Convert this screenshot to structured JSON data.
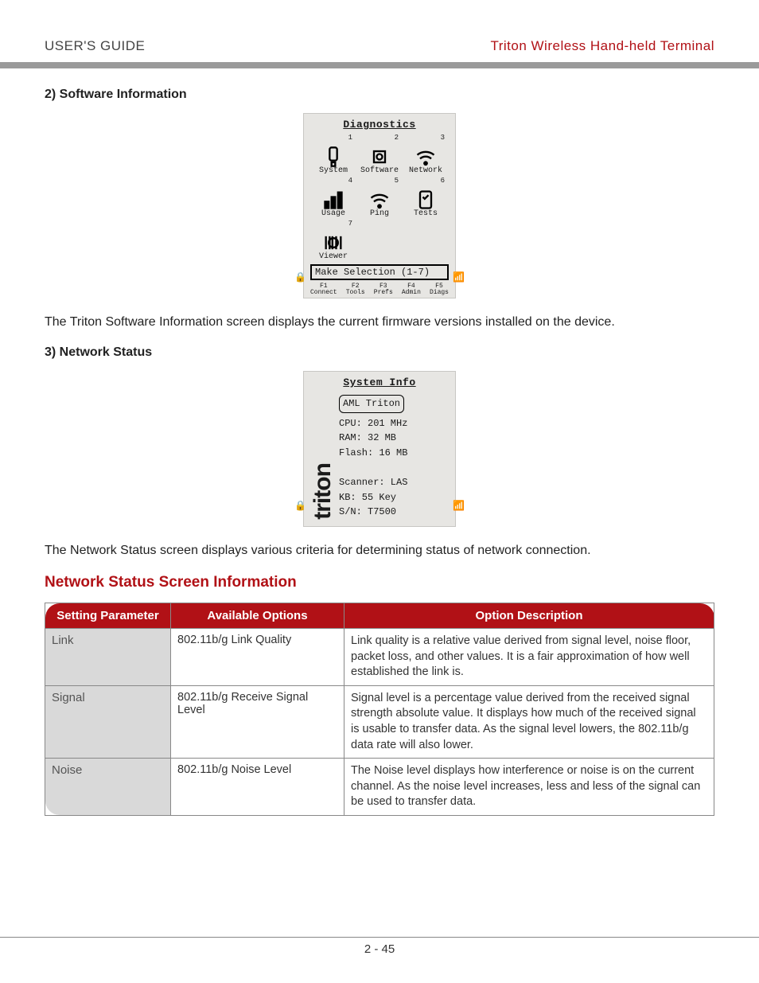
{
  "header": {
    "left": "USER'S GUIDE",
    "right": "Triton Wireless Hand-held Terminal"
  },
  "section1": {
    "heading": "2) Software Information",
    "body": "The Triton Software Information screen displays the current firmware versions installed on the device."
  },
  "fig_diag": {
    "title": "Diagnostics",
    "items": [
      {
        "num": "1",
        "label": "System",
        "icon": "device-icon"
      },
      {
        "num": "2",
        "label": "Software",
        "icon": "chip-icon"
      },
      {
        "num": "3",
        "label": "Network",
        "icon": "wifi-icon"
      },
      {
        "num": "4",
        "label": "Usage",
        "icon": "bars-icon"
      },
      {
        "num": "5",
        "label": "Ping",
        "icon": "wifi-icon"
      },
      {
        "num": "6",
        "label": "Tests",
        "icon": "clipboard-icon"
      },
      {
        "num": "7",
        "label": "Viewer",
        "icon": "barcode-icon"
      }
    ],
    "status": "Make Selection (1-7)",
    "softkeys": [
      "F1\nConnect",
      "F2\nTools",
      "F3\nPrefs",
      "F4\nAdmin",
      "F5\nDiags"
    ]
  },
  "section2": {
    "heading": "3) Network Status",
    "body": "The Network Status screen displays various criteria for determining status of network connection."
  },
  "fig_sys": {
    "title": "System Info",
    "device": "AML Triton",
    "lines": [
      "CPU: 201 MHz",
      "RAM:  32 MB",
      "Flash: 16 MB",
      "",
      "Scanner: LAS",
      "KB: 55 Key",
      "S/N: T7500"
    ]
  },
  "table": {
    "heading": "Network Status Screen Information",
    "columns": [
      "Setting Parameter",
      "Available Options",
      "Option Description"
    ],
    "rows": [
      {
        "param": "Link",
        "option": "802.11b/g Link Quality",
        "desc": "Link quality is a relative value derived from signal level, noise floor, packet loss, and other values. It is a fair approximation of how well established the link is."
      },
      {
        "param": "Signal",
        "option": "802.11b/g Receive Signal Level",
        "desc": "Signal level is a percentage value derived from the received signal strength absolute value. It displays how much of the received signal is usable to transfer data. As the signal level lowers, the 802.11b/g data rate will also lower."
      },
      {
        "param": "Noise",
        "option": "802.11b/g Noise Level",
        "desc": "The Noise level displays how interference or noise is on the current channel. As the noise level increases, less and less of the signal can be used to transfer data."
      }
    ]
  },
  "footer": {
    "page": "2 - 45"
  }
}
